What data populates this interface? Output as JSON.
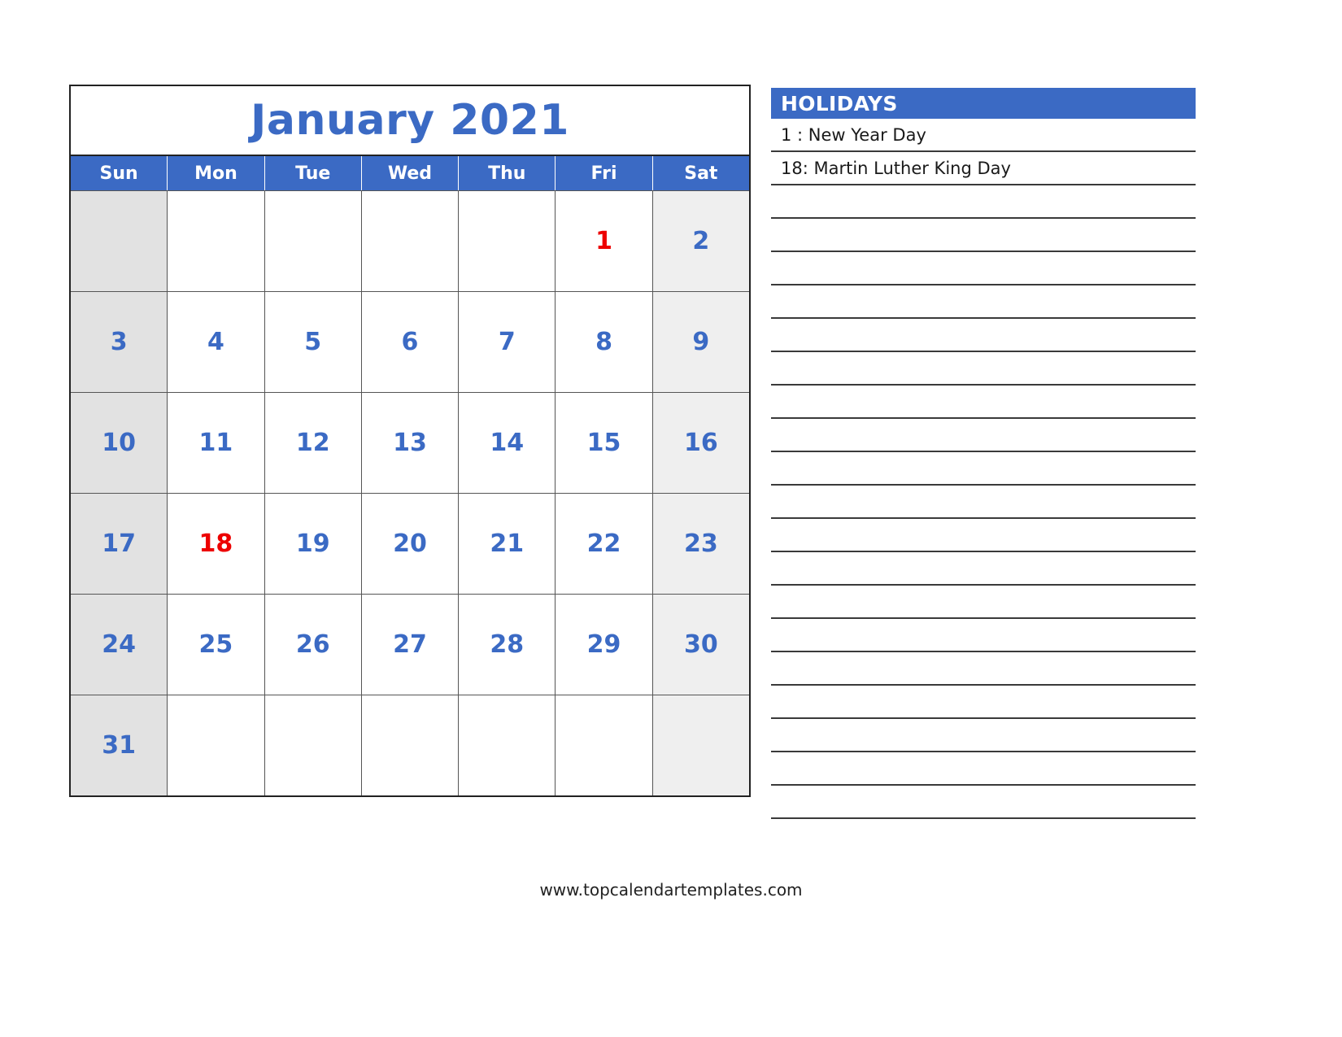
{
  "calendar": {
    "title": "January 2021",
    "weekdays": [
      "Sun",
      "Mon",
      "Tue",
      "Wed",
      "Thu",
      "Fri",
      "Sat"
    ],
    "accent_color": "#3B6AC4",
    "holiday_color": "#ED0000",
    "sunday_bg": "#E2E2E2",
    "saturday_bg": "#EFEFEF",
    "holiday_days": [
      1,
      18
    ],
    "weeks": [
      [
        {
          "day": ""
        },
        {
          "day": ""
        },
        {
          "day": ""
        },
        {
          "day": ""
        },
        {
          "day": ""
        },
        {
          "day": "1",
          "holiday": true
        },
        {
          "day": "2"
        }
      ],
      [
        {
          "day": "3"
        },
        {
          "day": "4"
        },
        {
          "day": "5"
        },
        {
          "day": "6"
        },
        {
          "day": "7"
        },
        {
          "day": "8"
        },
        {
          "day": "9"
        }
      ],
      [
        {
          "day": "10"
        },
        {
          "day": "11"
        },
        {
          "day": "12"
        },
        {
          "day": "13"
        },
        {
          "day": "14"
        },
        {
          "day": "15"
        },
        {
          "day": "16"
        }
      ],
      [
        {
          "day": "17"
        },
        {
          "day": "18",
          "holiday": true
        },
        {
          "day": "19"
        },
        {
          "day": "20"
        },
        {
          "day": "21"
        },
        {
          "day": "22"
        },
        {
          "day": "23"
        }
      ],
      [
        {
          "day": "24"
        },
        {
          "day": "25"
        },
        {
          "day": "26"
        },
        {
          "day": "27"
        },
        {
          "day": "28"
        },
        {
          "day": "29"
        },
        {
          "day": "30"
        }
      ],
      [
        {
          "day": "31"
        },
        {
          "day": ""
        },
        {
          "day": ""
        },
        {
          "day": ""
        },
        {
          "day": ""
        },
        {
          "day": ""
        },
        {
          "day": ""
        }
      ]
    ]
  },
  "holidays_panel": {
    "header": "HOLIDAYS",
    "entries": [
      "1 : New Year Day",
      "18: Martin Luther King Day"
    ],
    "blank_line_count": 19
  },
  "footer": {
    "url": "www.topcalendartemplates.com"
  }
}
